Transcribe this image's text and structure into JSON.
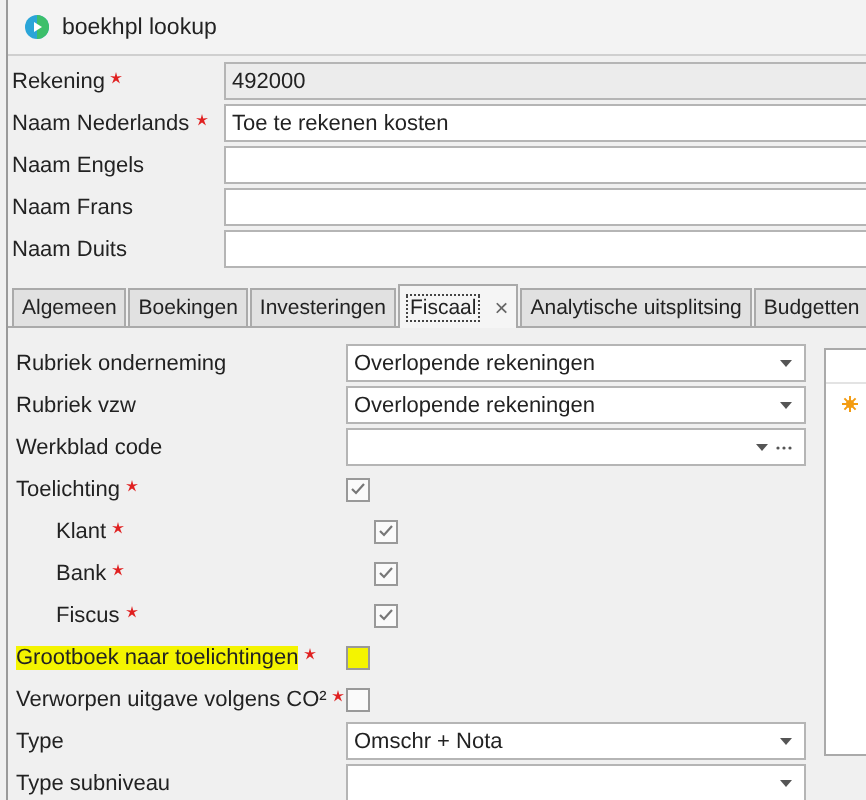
{
  "window": {
    "title": "boekhpl lookup"
  },
  "fields": [
    {
      "label": "Rekening",
      "required": true,
      "value": "492000",
      "readonly": true
    },
    {
      "label": "Naam Nederlands",
      "required": true,
      "value": "Toe te rekenen kosten",
      "readonly": false
    },
    {
      "label": "Naam Engels",
      "required": false,
      "readonly": false
    },
    {
      "label": "Naam Frans",
      "required": false,
      "readonly": false
    },
    {
      "label": "Naam Duits",
      "required": false,
      "readonly": false
    }
  ],
  "tabs": [
    {
      "label": "Algemeen",
      "selected": false
    },
    {
      "label": "Boekingen",
      "selected": false
    },
    {
      "label": "Investeringen",
      "selected": false
    },
    {
      "label": "Fiscaal",
      "selected": true,
      "close": "×"
    },
    {
      "label": "Analytische uitsplitsing",
      "selected": false
    },
    {
      "label": "Budgetten",
      "selected": false
    }
  ],
  "fiscaal": [
    {
      "kind": "dropdown",
      "label": "Rubriek onderneming",
      "required": false,
      "value": "Overlopende rekeningen"
    },
    {
      "kind": "dropdown",
      "label": "Rubriek vzw",
      "required": false,
      "value": "Overlopende rekeningen"
    },
    {
      "kind": "lookup",
      "label": "Werkblad code",
      "required": false
    },
    {
      "kind": "checkbox",
      "label": "Toelichting",
      "required": true,
      "checked": true,
      "indented": false,
      "highlighted": false
    },
    {
      "kind": "checkbox",
      "label": "Klant",
      "required": true,
      "checked": true,
      "indented": true,
      "highlighted": false
    },
    {
      "kind": "checkbox",
      "label": "Bank",
      "required": true,
      "checked": true,
      "indented": true,
      "highlighted": false
    },
    {
      "kind": "checkbox",
      "label": "Fiscus",
      "required": true,
      "checked": true,
      "indented": true,
      "highlighted": false
    },
    {
      "kind": "checkbox",
      "label": "Grootboek naar toelichtingen",
      "required": true,
      "checked": false,
      "indented": false,
      "highlighted": true
    },
    {
      "kind": "checkbox",
      "label": "Verworpen uitgave volgens CO²",
      "required": true,
      "checked": false,
      "indented": false,
      "highlighted": false
    },
    {
      "kind": "dropdown",
      "label": "Type",
      "required": false,
      "value": "Omschr + Nota"
    },
    {
      "kind": "dropdown",
      "label": "Type subniveau",
      "required": false
    }
  ]
}
